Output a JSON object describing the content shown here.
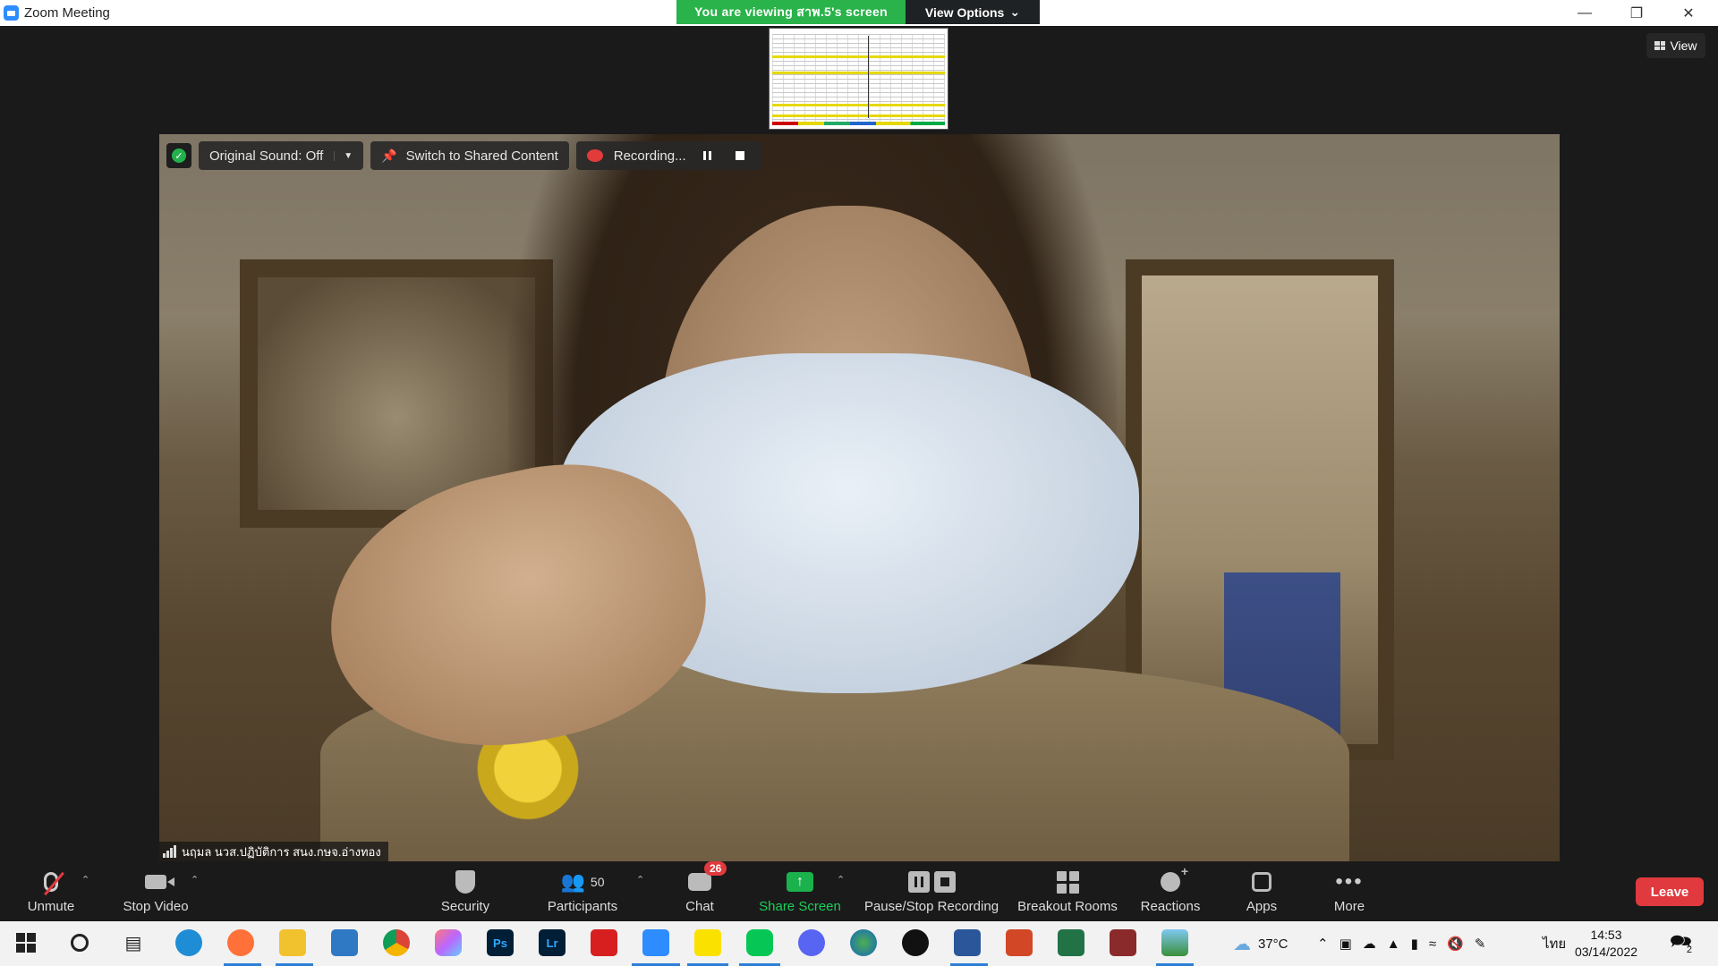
{
  "window": {
    "title": "Zoom Meeting",
    "controls": [
      "minimize",
      "restore",
      "close"
    ]
  },
  "share_banner": {
    "viewing_text": "You are viewing สาพ.5's screen",
    "view_options_label": "View Options",
    "green_color": "#2ab34a"
  },
  "view_button": {
    "label": "View"
  },
  "video_toolbar": {
    "original_sound_label": "Original Sound: Off",
    "switch_label": "Switch to Shared Content",
    "recording_label": "Recording..."
  },
  "participant": {
    "name": "นฤมล นวส.ปฏิบัติการ สนง.กษจ.อ่างทอง"
  },
  "controls": {
    "unmute": "Unmute",
    "stop_video": "Stop Video",
    "security": "Security",
    "participants": "Participants",
    "participants_count": "50",
    "chat": "Chat",
    "chat_badge": "26",
    "share_screen": "Share Screen",
    "pause_stop_recording": "Pause/Stop Recording",
    "breakout_rooms": "Breakout Rooms",
    "reactions": "Reactions",
    "apps": "Apps",
    "more": "More",
    "leave": "Leave",
    "leave_color": "#e0393e",
    "share_color": "#1bb14d"
  },
  "taskbar": {
    "apps": [
      "start",
      "search",
      "task-view",
      "edge",
      "firefox",
      "file-explorer",
      "mail",
      "chrome",
      "photo-app",
      "photoshop",
      "lightroom",
      "acrobat",
      "zoom",
      "kakao-player",
      "line",
      "discord",
      "globe-app",
      "media-player",
      "word",
      "powerpoint",
      "excel",
      "game-app",
      "photos"
    ],
    "ps_label": "Ps",
    "lr_label": "Lr",
    "temperature": "37°C",
    "language": "ไทย",
    "time": "14:53",
    "date": "03/14/2022",
    "notification_count": "2"
  }
}
